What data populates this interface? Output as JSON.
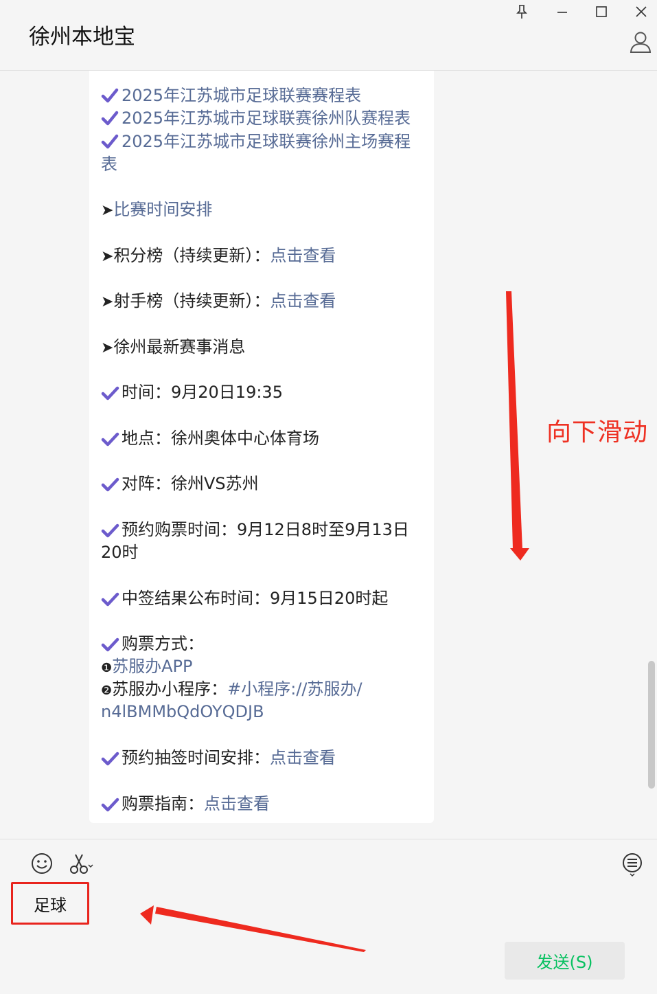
{
  "window": {
    "title": "徐州本地宝"
  },
  "message": {
    "links_top": [
      "2025年江苏城市足球联赛赛程表",
      "2025年江苏城市足球联赛徐州队赛程表",
      "2025年江苏城市足球联赛徐州主场赛程",
      "表"
    ],
    "schedule_link": "比赛时间安排",
    "standings_label": "积分榜（持续更新）：",
    "standings_link": "点击查看",
    "scorers_label": "射手榜（持续更新）：",
    "scorers_link": "点击查看",
    "news_label": "徐州最新赛事消息",
    "time": "时间：9月20日19:35",
    "venue": "地点：徐州奥体中心体育场",
    "match": "对阵：徐州VS苏州",
    "booking_line1": "预约购票时间：9月12日8时至9月13日",
    "booking_line2": "20时",
    "result_time": "中签结果公布时间：9月15日20时起",
    "buy_method": "购票方式：",
    "method1_num": "❶",
    "method1_link": "苏服办APP",
    "method2_num": "❷",
    "method2_label": "苏服办小程序：",
    "method2_link1": "#小程序://苏服办/",
    "method2_link2": "n4lBMMbQdOYQDJB",
    "lottery_label": "预约抽签时间安排：",
    "lottery_link": "点击查看",
    "guide_label": "购票指南：",
    "guide_link": "点击查看"
  },
  "annotation": {
    "scroll_hint": "向下滑动"
  },
  "input": {
    "value": "足球"
  },
  "send_button": "发送(S)",
  "colors": {
    "link": "#576b95",
    "check": "#6c5bcc",
    "annotation_red": "#ee3123",
    "send_text": "#07c160"
  }
}
